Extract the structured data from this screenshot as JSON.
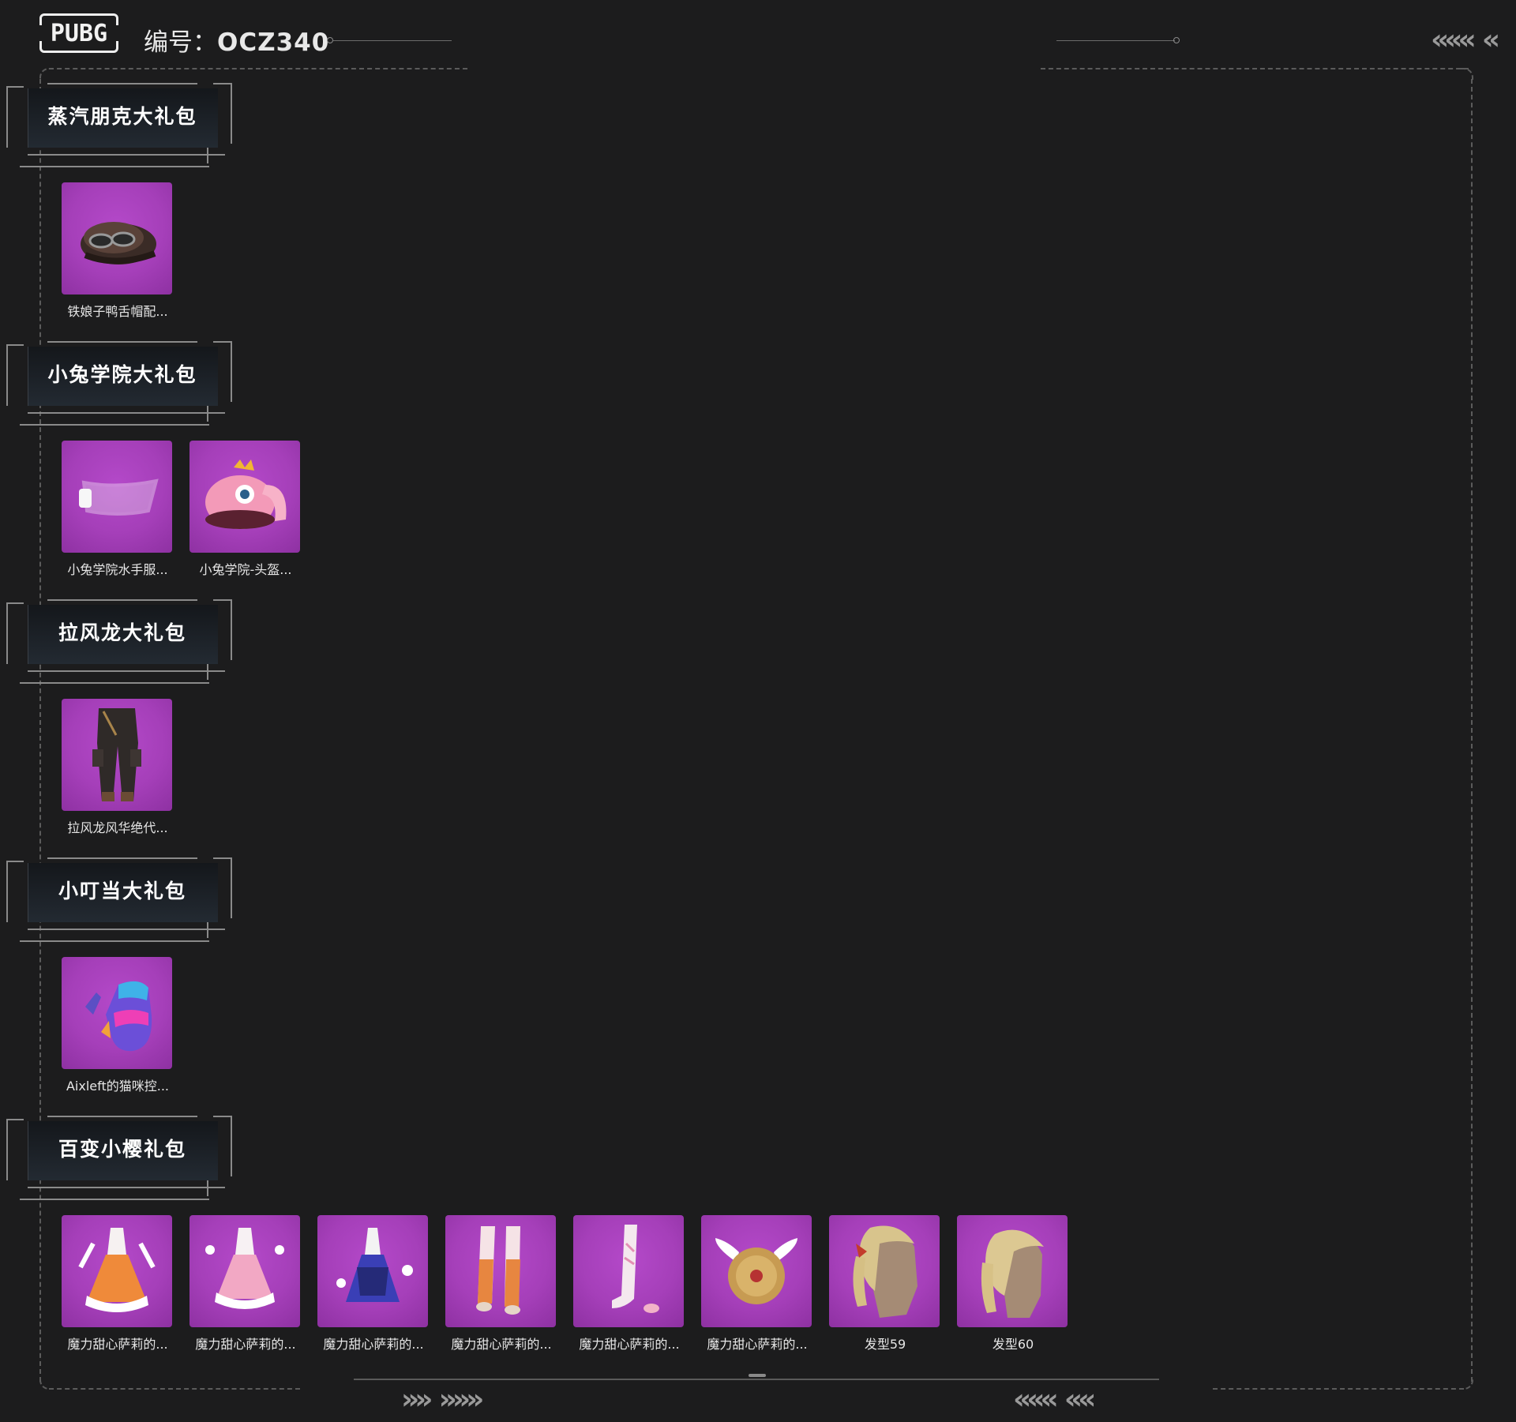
{
  "header": {
    "logo_text": "PUBG",
    "code_label": "编号：",
    "code_value": "OCZ340"
  },
  "sections": [
    {
      "title": "蒸汽朋克大礼包",
      "items": [
        {
          "label": "铁娘子鸭舌帽配...",
          "icon": "cap-icon"
        }
      ]
    },
    {
      "title": "小兔学院大礼包",
      "items": [
        {
          "label": "小兔学院水手服...",
          "icon": "mask-icon"
        },
        {
          "label": "小兔学院-头盔...",
          "icon": "bunny-helmet-icon"
        }
      ]
    },
    {
      "title": "拉风龙大礼包",
      "items": [
        {
          "label": "拉风龙风华绝代...",
          "icon": "pants-icon"
        }
      ]
    },
    {
      "title": "小叮当大礼包",
      "items": [
        {
          "label": "Aixleft的猫咪控...",
          "icon": "gloves-icon"
        }
      ]
    },
    {
      "title": "百变小樱礼包",
      "items": [
        {
          "label": "魔力甜心萨莉的...",
          "icon": "dress-orange-icon"
        },
        {
          "label": "魔力甜心萨莉的...",
          "icon": "dress-pink-icon"
        },
        {
          "label": "魔力甜心萨莉的...",
          "icon": "dress-blue-icon"
        },
        {
          "label": "魔力甜心萨莉的...",
          "icon": "boots-orange-icon"
        },
        {
          "label": "魔力甜心萨莉的...",
          "icon": "boots-pink-icon"
        },
        {
          "label": "魔力甜心萨莉的...",
          "icon": "winged-backpack-icon"
        },
        {
          "label": "发型59",
          "icon": "hairstyle-icon"
        },
        {
          "label": "发型60",
          "icon": "hairstyle-icon"
        }
      ]
    }
  ],
  "colors": {
    "background": "#1c1c1d",
    "item_bg": "#a53fb9",
    "plate": "#1d2228"
  }
}
